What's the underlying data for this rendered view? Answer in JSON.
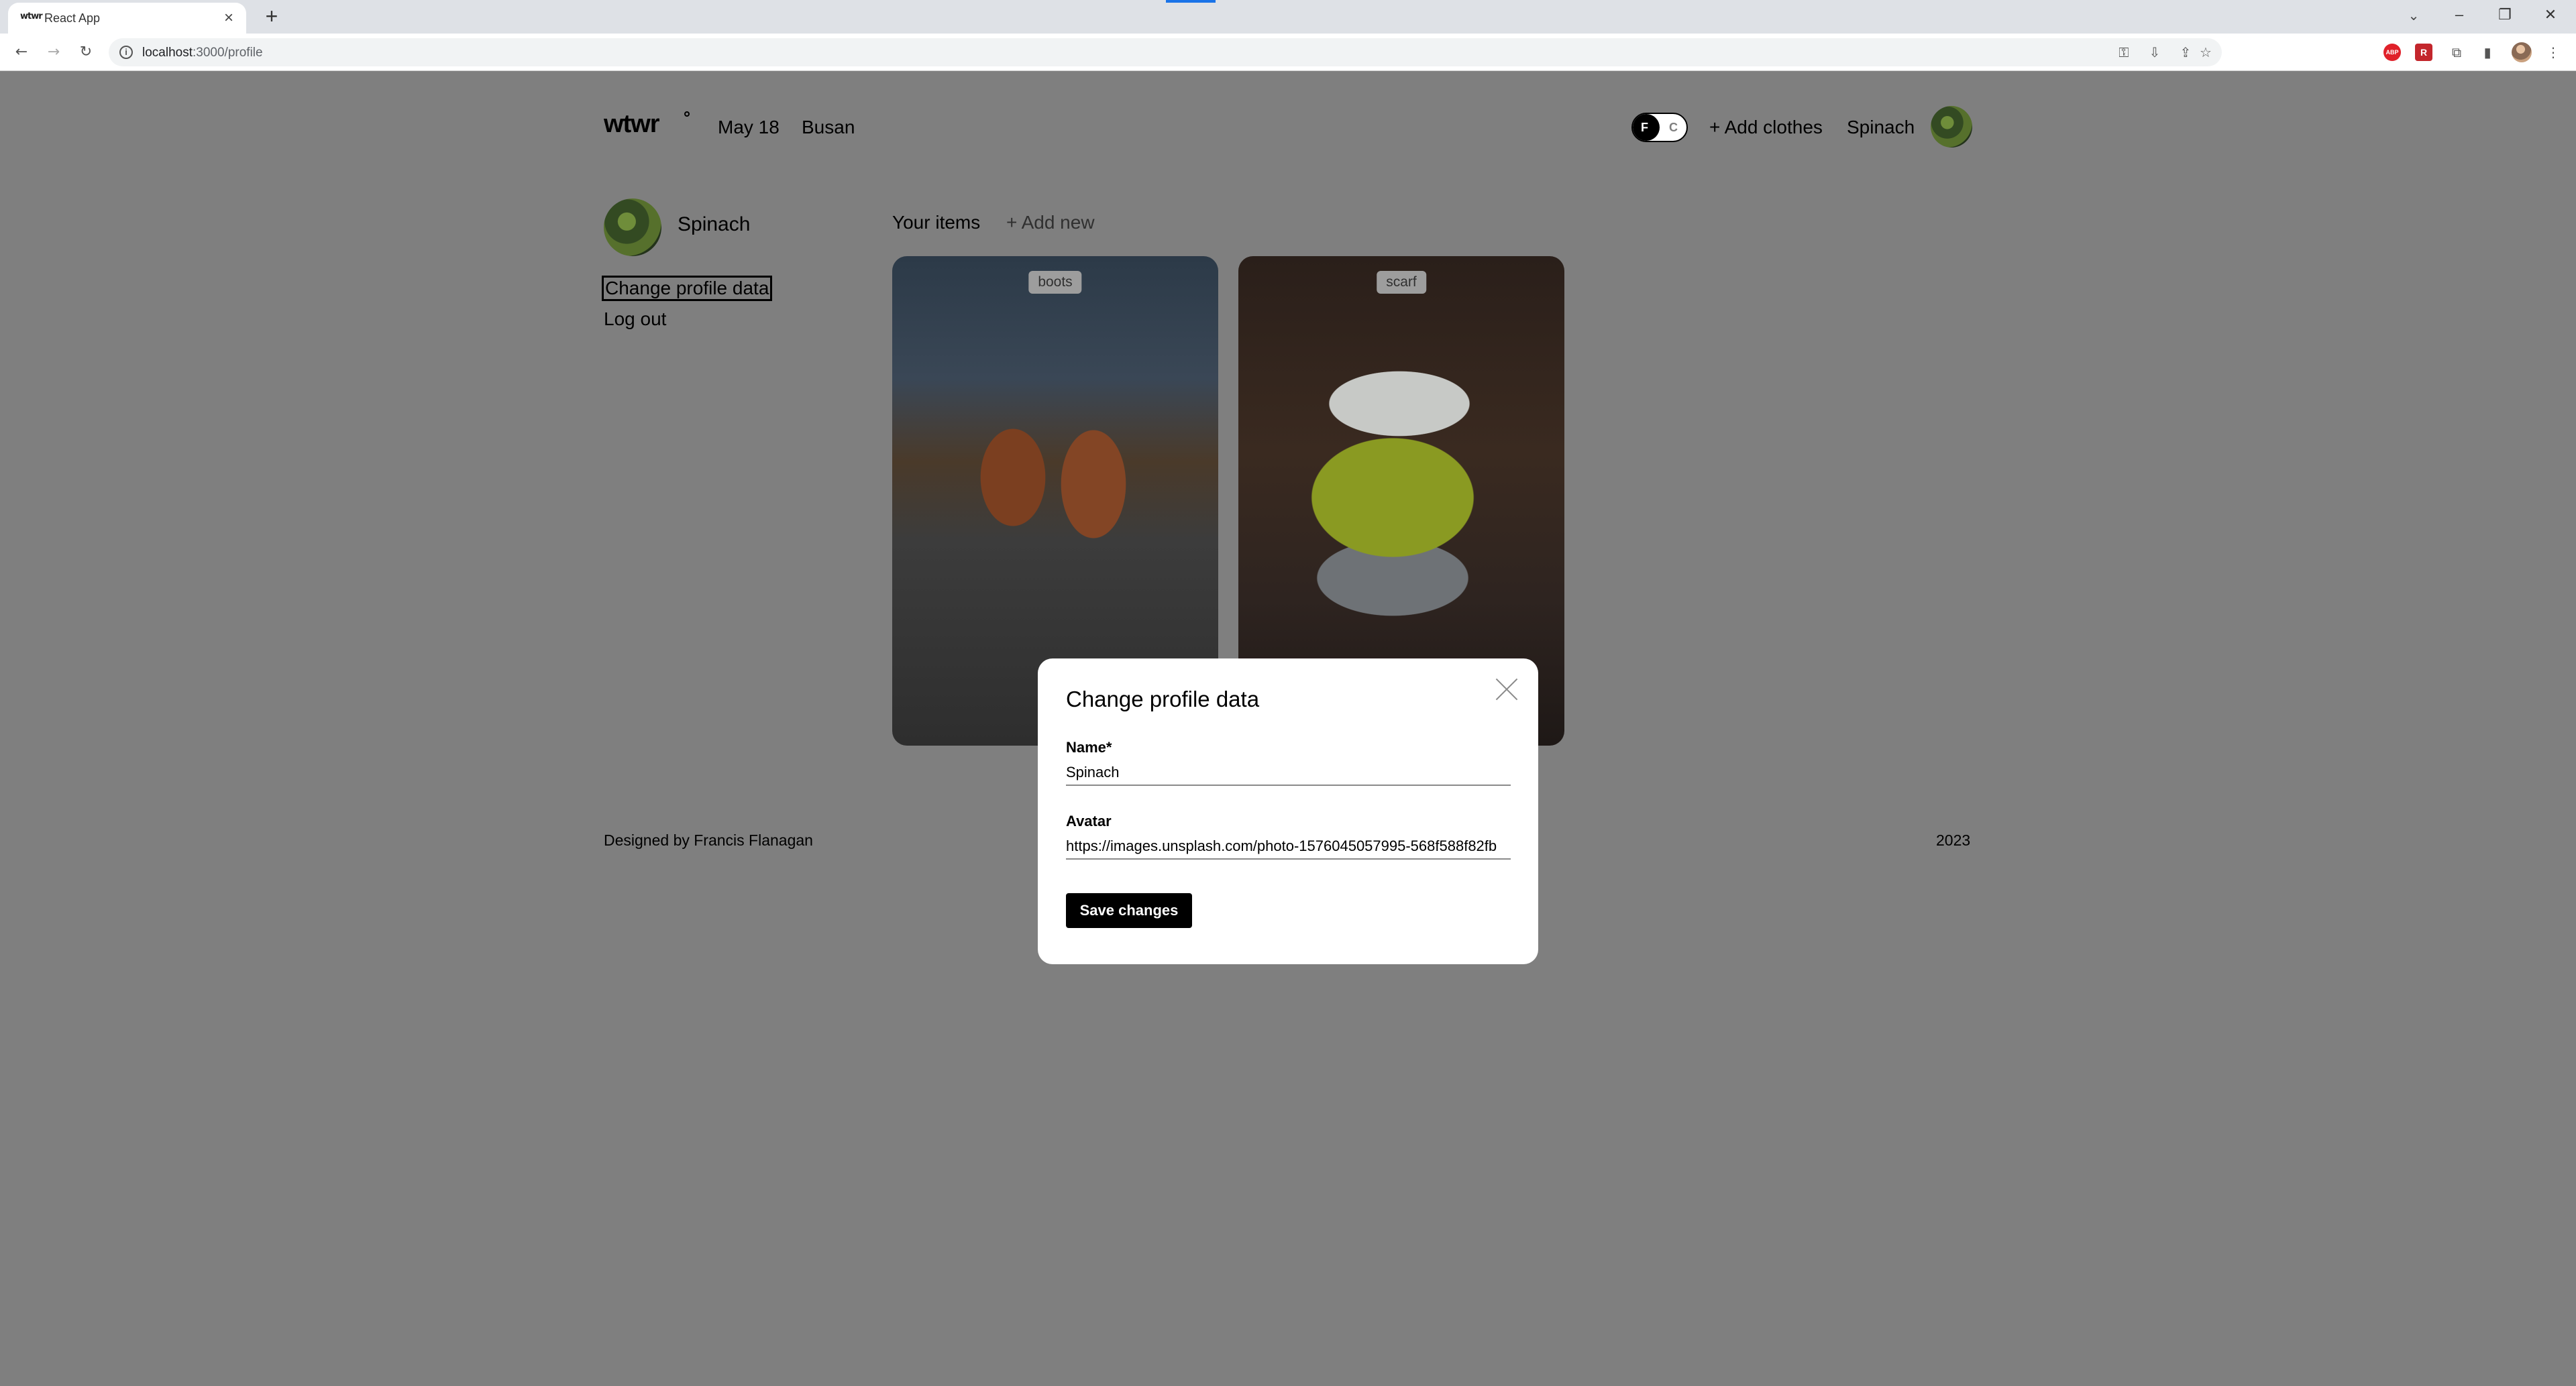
{
  "browser": {
    "tab_title": "React App",
    "favicon_text": "wtwr",
    "url_host": "localhost",
    "url_rest": ":3000/profile",
    "accent": "#1a73e8"
  },
  "header": {
    "logo": "wtwr",
    "date": "May 18",
    "location": "Busan",
    "toggle_f": "F",
    "toggle_c": "C",
    "add_clothes": "+ Add clothes",
    "username": "Spinach"
  },
  "sidebar": {
    "username": "Spinach",
    "change_profile": "Change profile data",
    "logout": "Log out"
  },
  "items": {
    "title": "Your items",
    "add_new": "+ Add new",
    "cards": [
      {
        "label": "boots"
      },
      {
        "label": "scarf"
      }
    ]
  },
  "footer": {
    "designed_by": "Designed by Francis Flanagan",
    "year": "2023"
  },
  "modal": {
    "title": "Change profile data",
    "name_label": "Name*",
    "name_value": "Spinach",
    "avatar_label": "Avatar",
    "avatar_value": "https://images.unsplash.com/photo-1576045057995-568f588f82fb",
    "save_label": "Save changes"
  }
}
